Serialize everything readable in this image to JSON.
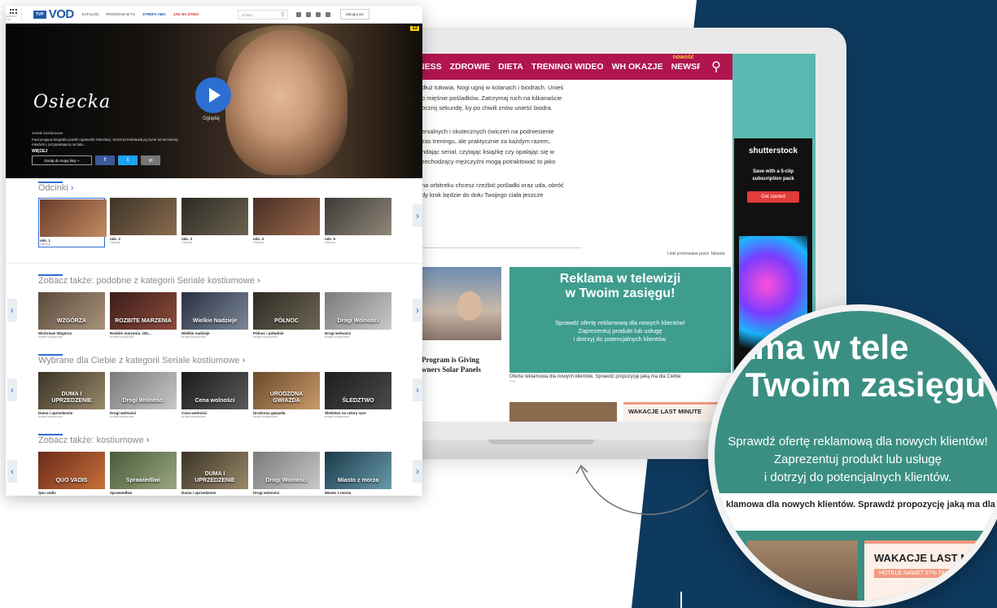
{
  "vod": {
    "brand_small": "TVP",
    "brand": "VOD",
    "grid_label": "SERWISY TVP",
    "menu": [
      "KATALOG",
      "PROGRAM W TV",
      "STREFA ABO",
      "JAK NA ŻYWO"
    ],
    "search_placeholder": "szukaj",
    "login": "Zaloguj się",
    "hero": {
      "age_rating": "12",
      "title": "Osiecka",
      "play_label": "Oglądaj",
      "genre": "seriale kostiumowe",
      "description": "Fascynująca biografia poetki Agnieszki Osieckiej. Serial przedstawia jej życie od wczesnej młodości, przypadającej na lata...",
      "more": "WIĘCEJ",
      "add_to_list": "Dodaj do mojej listy +",
      "fb": "f",
      "tw": "t",
      "mail": "✉"
    },
    "episodes": {
      "title": "Odcinki",
      "items": [
        {
          "title": "odc. 1",
          "sub": "Osiecka",
          "color1": "#6b3c2a",
          "color2": "#c28b63"
        },
        {
          "title": "odc. 2",
          "sub": "Osiecka",
          "color1": "#3c3428",
          "color2": "#8a6b4f"
        },
        {
          "title": "odc. 3",
          "sub": "Osiecka",
          "color1": "#2d2a24",
          "color2": "#6b6350"
        },
        {
          "title": "odc. 4",
          "sub": "Osiecka",
          "color1": "#4a2e24",
          "color2": "#9b6b4f"
        },
        {
          "title": "odc. 5",
          "sub": "Osiecka",
          "color1": "#3d3a36",
          "color2": "#8f8779"
        }
      ]
    },
    "similar": {
      "title": "Zobacz także: podobne z kategorii Seriale kostiumowe",
      "items": [
        {
          "title": "Wichrowe Wzgórza",
          "sub": "seriale kostiumowe",
          "img_text": "WZGÓRZA",
          "color1": "#5a4a3c",
          "color2": "#a8927a"
        },
        {
          "title": "Rozbite marzenia. 191...",
          "sub": "seriale kostiumowe",
          "img_text": "ROZBITE MARZENIA",
          "color1": "#3b1e1a",
          "color2": "#8c4a3a"
        },
        {
          "title": "Wielkie nadzieje",
          "sub": "seriale kostiumowe",
          "img_text": "Wielkie Nadzieje",
          "color1": "#2a3040",
          "color2": "#7a8898"
        },
        {
          "title": "Północ i południe",
          "sub": "seriale kostiumowe",
          "img_text": "PÓŁNOC",
          "color1": "#2e2a22",
          "color2": "#6d6656"
        },
        {
          "title": "Drogi wolności",
          "sub": "seriale kostiumowe",
          "img_text": "Drogi Wolności",
          "color1": "#7a7a7a",
          "color2": "#c8c8c8"
        }
      ]
    },
    "for_you": {
      "title": "Wybrane dla Ciebie z kategorii Seriale kostiumowe",
      "items": [
        {
          "title": "Duma i uprzedzenie",
          "sub": "seriale kostiumowe",
          "img_text": "DUMA I UPRZEDZENIE",
          "color1": "#3a3226",
          "color2": "#9a8a6a"
        },
        {
          "title": "Drogi wolności",
          "sub": "seriale kostiumowe",
          "img_text": "Drogi Wolności",
          "color1": "#7a7a7a",
          "color2": "#c8c8c8"
        },
        {
          "title": "Cena wolności",
          "sub": "seriale kostiumowe",
          "img_text": "Cena wolności",
          "color1": "#1a1a1a",
          "color2": "#5a5a5a"
        },
        {
          "title": "Urodzona gwiazda",
          "sub": "seriale kostiumowe",
          "img_text": "URODZONA GWIAZDA",
          "color1": "#6a4a2a",
          "color2": "#c89a6a"
        },
        {
          "title": "Śledztwo na cztery ręce",
          "sub": "seriale kostiumowe",
          "img_text": "ŚLEDZTWO",
          "color1": "#1e1e1e",
          "color2": "#4a4a4a"
        }
      ]
    },
    "related": {
      "title": "Zobacz także: kostiumowe",
      "items": [
        {
          "title": "Quo vadis",
          "sub": "",
          "img_text": "QUO VADIS",
          "color1": "#6a2a1a",
          "color2": "#c8703a"
        },
        {
          "title": "Sprawiedliwi",
          "sub": "",
          "img_text": "Sprawiedliwi",
          "color1": "#4a5a3a",
          "color2": "#9aa880"
        },
        {
          "title": "Duma i uprzedzenie",
          "sub": "",
          "img_text": "DUMA I UPRZEDZENIE",
          "color1": "#3a3226",
          "color2": "#9a8a6a"
        },
        {
          "title": "Drogi wolności",
          "sub": "",
          "img_text": "Drogi Wolności",
          "color1": "#7a7a7a",
          "color2": "#c8c8c8"
        },
        {
          "title": "Miasto z morza",
          "sub": "",
          "img_text": "Miasto z morza",
          "color1": "#1a3a4a",
          "color2": "#6a9aaa"
        }
      ]
    }
  },
  "article": {
    "nav": [
      "NESS",
      "ZDROWIE",
      "DIETA",
      "TRENINGI WIDEO",
      "WH OKAZJE",
      "NEWSROOM"
    ],
    "nav_badge": "nowość",
    "paragraphs": [
      "dłuż tułowia. Nogi ugnij w kolanach i biodrach. Unieś\no mięśnie pośladków. Zatrzymaj ruch na kilkanaście\nocznij sekundę, by po chwili znów unieść biodra.",
      "ersalnych i skutecznych ćwiczeń na podniesienie\nzas treningu, ale praktycznie za każdym razem,\nndając serial, czytając książkę czy opalając się w\nzechodzący mężczyźni mogą potraktować to jako",
      "na orbitreku chcesz rzeźbić pośladki oraz uda, obróć\ndy krok będzie do dołu Twojego ciała  jeszcze"
    ],
    "taboola": "Linki promowane przez Taboola",
    "teaser": "Program is Giving\nwners Solar Panels",
    "ad_head": "Reklama w telewizji\nw Twoim zasięgu!",
    "ad_sub": "Sprawdź ofertę reklamową dla nowych klientów!\nZaprezentuj produkt lub usługę\ni dotrzyj do potencjalnych klientów.",
    "ad_caption": "Oferta reklamowa dla nowych klientów. Sprawdź propozycję jaką ma dla Ciebie",
    "ad_caption_sub": "TVP",
    "promo": "WAKACJE LAST MINUTE",
    "shutter_logo": "shutterstock",
    "shutter_text": "Save with a 5-clip\nsubscription pack",
    "shutter_btn": "Get started"
  },
  "magnifier": {
    "head": "ama w tele\n Twoim zasięgu",
    "sub": "Sprawdź ofertę reklamową dla nowych klientów!\nZaprezentuj produkt lub usługę\ni dotrzyj do potencjalnych klientów.",
    "caption": "klamowa dla nowych klientów. Sprawdź propozycję jaką ma dla",
    "promo": "WAKACJE LAST M",
    "promo_tag": "HOTELE NAWET 57% TAN"
  }
}
